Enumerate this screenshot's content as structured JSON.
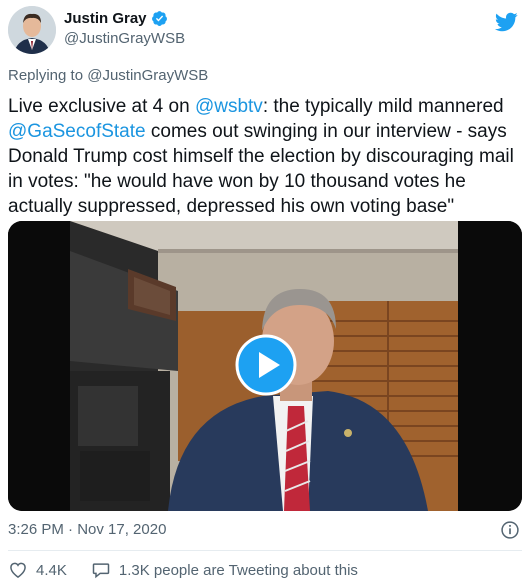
{
  "author": {
    "name": "Justin Gray",
    "handle": "@JustinGrayWSB",
    "verified_icon": "verified-badge-icon",
    "avatar": "avatar"
  },
  "brand": {
    "icon": "twitter-bird-icon",
    "color": "#1da1f2"
  },
  "reply": {
    "label": "Replying to @JustinGrayWSB"
  },
  "tweet": {
    "part1": "Live exclusive at 4 on ",
    "mention1": "@wsbtv",
    "part2": ": the typically mild mannered ",
    "mention2": "@GaSecofState",
    "part3": " comes out swinging in our interview - says Donald Trump cost himself the election by discouraging mail in votes: \"he would have won by 10 thousand votes he actually suppressed, depressed his own voting base\""
  },
  "video": {
    "play_icon": "play-icon"
  },
  "meta": {
    "timestamp": "3:26 PM · Nov 17, 2020",
    "info_icon": "info-icon"
  },
  "actions": {
    "likes": "4.4K",
    "conversation": "1.3K people are Tweeting about this",
    "like_icon": "heart-icon",
    "reply_icon": "speech-bubble-icon"
  }
}
